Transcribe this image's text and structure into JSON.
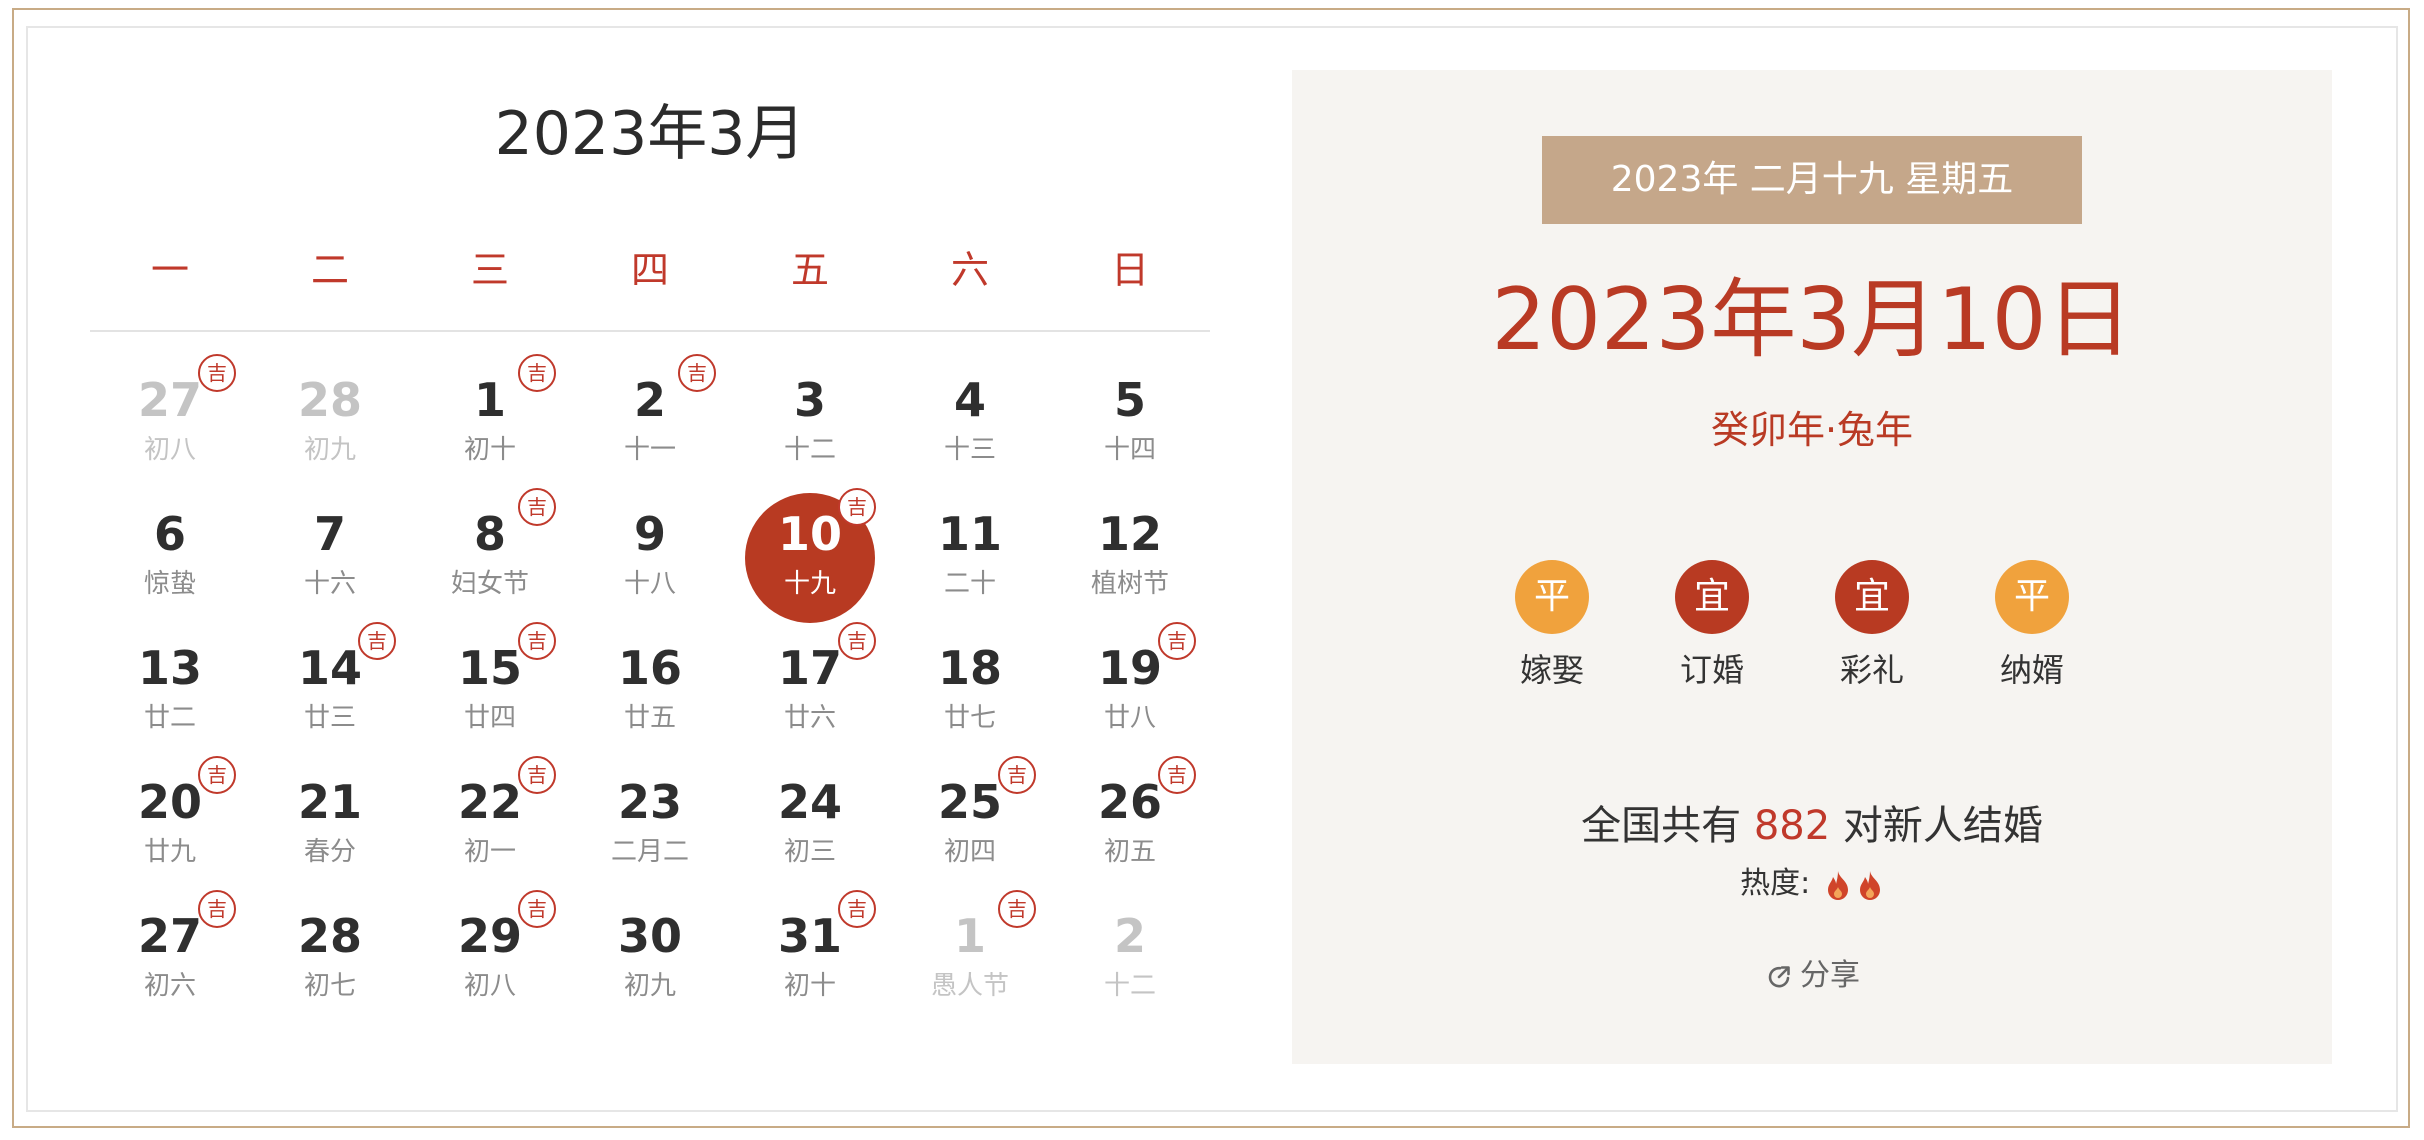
{
  "calendar": {
    "title": "2023年3月",
    "weekdays": [
      "一",
      "二",
      "三",
      "四",
      "五",
      "六",
      "日"
    ],
    "ji_label": "吉",
    "weeks": [
      [
        {
          "num": "27",
          "lunar": "初八",
          "other": true,
          "ji": true
        },
        {
          "num": "28",
          "lunar": "初九",
          "other": true,
          "ji": false
        },
        {
          "num": "1",
          "lunar": "初十",
          "other": false,
          "ji": true
        },
        {
          "num": "2",
          "lunar": "十一",
          "other": false,
          "ji": true
        },
        {
          "num": "3",
          "lunar": "十二",
          "other": false,
          "ji": false
        },
        {
          "num": "4",
          "lunar": "十三",
          "other": false,
          "ji": false
        },
        {
          "num": "5",
          "lunar": "十四",
          "other": false,
          "ji": false
        }
      ],
      [
        {
          "num": "6",
          "lunar": "惊蛰",
          "other": false,
          "ji": false
        },
        {
          "num": "7",
          "lunar": "十六",
          "other": false,
          "ji": false
        },
        {
          "num": "8",
          "lunar": "妇女节",
          "other": false,
          "ji": true
        },
        {
          "num": "9",
          "lunar": "十八",
          "other": false,
          "ji": false
        },
        {
          "num": "10",
          "lunar": "十九",
          "other": false,
          "ji": true,
          "selected": true
        },
        {
          "num": "11",
          "lunar": "二十",
          "other": false,
          "ji": false
        },
        {
          "num": "12",
          "lunar": "植树节",
          "other": false,
          "ji": false
        }
      ],
      [
        {
          "num": "13",
          "lunar": "廿二",
          "other": false,
          "ji": false
        },
        {
          "num": "14",
          "lunar": "廿三",
          "other": false,
          "ji": true
        },
        {
          "num": "15",
          "lunar": "廿四",
          "other": false,
          "ji": true
        },
        {
          "num": "16",
          "lunar": "廿五",
          "other": false,
          "ji": false
        },
        {
          "num": "17",
          "lunar": "廿六",
          "other": false,
          "ji": true
        },
        {
          "num": "18",
          "lunar": "廿七",
          "other": false,
          "ji": false
        },
        {
          "num": "19",
          "lunar": "廿八",
          "other": false,
          "ji": true
        }
      ],
      [
        {
          "num": "20",
          "lunar": "廿九",
          "other": false,
          "ji": true
        },
        {
          "num": "21",
          "lunar": "春分",
          "other": false,
          "ji": false
        },
        {
          "num": "22",
          "lunar": "初一",
          "other": false,
          "ji": true
        },
        {
          "num": "23",
          "lunar": "二月二",
          "other": false,
          "ji": false
        },
        {
          "num": "24",
          "lunar": "初三",
          "other": false,
          "ji": false
        },
        {
          "num": "25",
          "lunar": "初四",
          "other": false,
          "ji": true
        },
        {
          "num": "26",
          "lunar": "初五",
          "other": false,
          "ji": true
        }
      ],
      [
        {
          "num": "27",
          "lunar": "初六",
          "other": false,
          "ji": true
        },
        {
          "num": "28",
          "lunar": "初七",
          "other": false,
          "ji": false
        },
        {
          "num": "29",
          "lunar": "初八",
          "other": false,
          "ji": true
        },
        {
          "num": "30",
          "lunar": "初九",
          "other": false,
          "ji": false
        },
        {
          "num": "31",
          "lunar": "初十",
          "other": false,
          "ji": true
        },
        {
          "num": "1",
          "lunar": "愚人节",
          "other": true,
          "ji": true
        },
        {
          "num": "2",
          "lunar": "十二",
          "other": true,
          "ji": false
        }
      ]
    ]
  },
  "detail": {
    "lunar_banner": "2023年  二月十九  星期五",
    "big_date": "2023年3月10日",
    "ganzhi": "癸卯年·兔年",
    "activities": [
      {
        "badge": "平",
        "label": "嫁娶",
        "kind": "ping"
      },
      {
        "badge": "宜",
        "label": "订婚",
        "kind": "yi"
      },
      {
        "badge": "宜",
        "label": "彩礼",
        "kind": "yi"
      },
      {
        "badge": "平",
        "label": "纳婿",
        "kind": "ping"
      }
    ],
    "count_prefix": "全国共有",
    "count": "882",
    "count_suffix": "对新人结婚",
    "heat_label": "热度:",
    "heat_level": 2,
    "share_label": "分享"
  },
  "colors": {
    "accent": "#b93a24",
    "ping": "#f0a23d",
    "banner": "#c5a78a",
    "frame": "#c8ab86"
  },
  "icons": {
    "ji": "ji-badge-icon",
    "flame": "flame-icon",
    "share": "share-icon"
  }
}
